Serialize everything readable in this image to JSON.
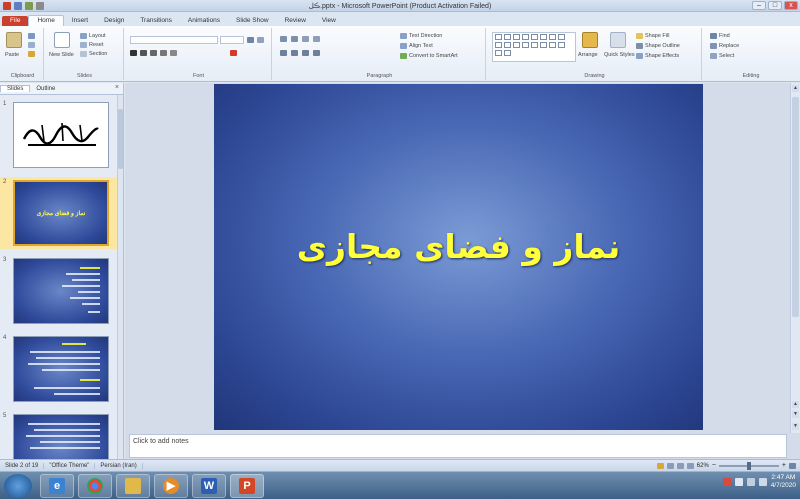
{
  "window": {
    "title": "ڪل.pptx - Microsoft PowerPoint (Product Activation Failed)",
    "minimize": "–",
    "maximize": "□",
    "close": "x"
  },
  "tabs": [
    "File",
    "Home",
    "Insert",
    "Design",
    "Transitions",
    "Animations",
    "Slide Show",
    "Review",
    "View"
  ],
  "ribbon": {
    "groups": {
      "clipboard": "Clipboard",
      "slides": "Slides",
      "font": "Font",
      "paragraph": "Paragraph",
      "drawing": "Drawing",
      "editing": "Editing"
    },
    "clipboard": {
      "paste": "Paste"
    },
    "slides": {
      "new_slide": "New Slide",
      "layout": "Layout",
      "reset": "Reset",
      "section": "Section"
    },
    "paragraph": {
      "text_direction": "Text Direction",
      "align_text": "Align Text",
      "convert_smartart": "Convert to SmartArt"
    },
    "drawing": {
      "arrange": "Arrange",
      "quick_styles": "Quick Styles",
      "shape_fill": "Shape Fill",
      "shape_outline": "Shape Outline",
      "shape_effects": "Shape Effects"
    },
    "editing": {
      "find": "Find",
      "replace": "Replace",
      "select": "Select"
    }
  },
  "panel": {
    "tabs": [
      "Slides",
      "Outline"
    ],
    "slides": [
      {
        "num": "1",
        "caption": ""
      },
      {
        "num": "2",
        "caption": "نماز و فضای مجازی"
      },
      {
        "num": "3",
        "caption": ""
      },
      {
        "num": "4",
        "caption": ""
      },
      {
        "num": "5",
        "caption": ""
      }
    ]
  },
  "slide": {
    "title": "نماز و فضای مجازی"
  },
  "notes": {
    "placeholder": "Click to add notes"
  },
  "status": {
    "slide_info": "Slide 2 of 19",
    "theme": "\"Office Theme\"",
    "language": "Persian (Iran)",
    "zoom": "62%"
  },
  "taskbar": {
    "apps": [
      "ie",
      "chrome",
      "explorer",
      "media",
      "word",
      "powerpoint"
    ],
    "clock_time": "2:47 AM",
    "clock_date": "4/7/2020"
  },
  "colors": {
    "slide_title": "#ffff3a",
    "slide_bg": "#3a56a6",
    "file_tab": "#c9412c"
  }
}
